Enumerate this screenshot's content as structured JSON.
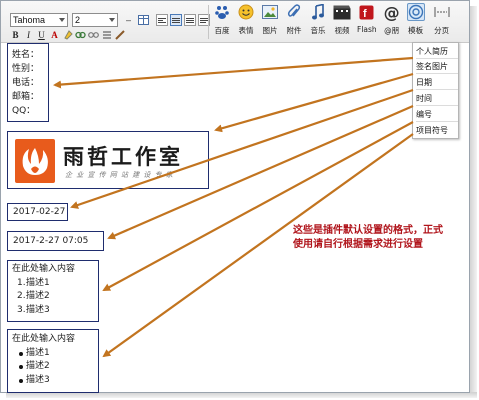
{
  "toolbar": {
    "font_select": "Tahoma",
    "size_select": "2",
    "buttons": [
      {
        "label": "百度",
        "icon": "baidu-icon"
      },
      {
        "label": "表情",
        "icon": "emoticon-icon"
      },
      {
        "label": "图片",
        "icon": "image-icon"
      },
      {
        "label": "附件",
        "icon": "attachment-icon"
      },
      {
        "label": "音乐",
        "icon": "music-icon"
      },
      {
        "label": "视频",
        "icon": "video-icon"
      },
      {
        "label": "Flash",
        "icon": "flash-icon"
      },
      {
        "label": "@朋",
        "icon": "at-icon"
      },
      {
        "label": "模板",
        "icon": "template-icon"
      },
      {
        "label": "分页",
        "icon": "page-break-icon"
      }
    ]
  },
  "menu": {
    "items": [
      "个人简历",
      "签名图片",
      "日期",
      "时间",
      "编号",
      "项目符号"
    ]
  },
  "contact": {
    "lines": [
      "姓名：",
      "性别：",
      "电话：",
      "邮箱：",
      "QQ："
    ]
  },
  "banner": {
    "title": "雨哲工作室",
    "subtitle": "企业宣传网站建设专家"
  },
  "date_value": "2017-02-27",
  "datetime_value": "2017-2-27 07:05",
  "ordered_list": {
    "heading": "在此处输入内容",
    "items": [
      "描述1",
      "描述2",
      "描述3"
    ],
    "numbers": [
      "1.",
      "2.",
      "3."
    ]
  },
  "unordered_list": {
    "heading": "在此处输入内容",
    "items": [
      "描述1",
      "描述2",
      "描述3"
    ]
  },
  "note": "这些是插件默认设置的格式，正式使用请自行根据需求进行设置",
  "colors": {
    "arrow": "#c2741f",
    "box_border": "#1f2d6e",
    "note_text": "#b0141b",
    "logo_orange": "#e85b1c"
  }
}
